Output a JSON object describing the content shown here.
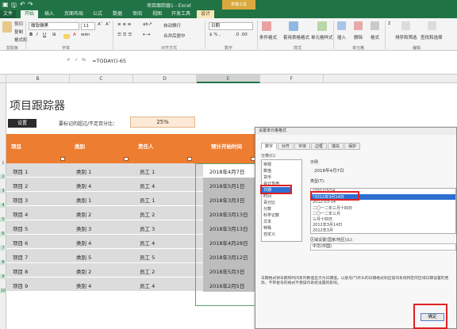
{
  "window": {
    "title": "项目跟踪器1 - Excel",
    "tool_tab": "表格工具"
  },
  "tabs": [
    "文件",
    "开始",
    "插入",
    "页面布局",
    "公式",
    "数据",
    "审阅",
    "视图",
    "开发工具",
    "设计"
  ],
  "ribbon": {
    "clipboard": {
      "cut": "剪切",
      "copy": "复制",
      "format_painter": "格式刷",
      "group": "剪贴板"
    },
    "font": {
      "name": "微软雅黑",
      "size": "11",
      "group": "字体"
    },
    "align": {
      "wrap": "自动换行",
      "merge": "合并后居中",
      "group": "对齐方式"
    },
    "number": {
      "format": "日期",
      "group": "数字"
    },
    "styles": {
      "cond": "条件格式",
      "table": "套用表格格式",
      "cell": "单元格样式",
      "group": "样式"
    },
    "cells": {
      "insert": "插入",
      "delete": "删除",
      "format": "格式",
      "group": "单元格"
    },
    "edit": {
      "sort": "排序和筛选",
      "find": "查找和选择",
      "group": "编辑"
    }
  },
  "formula": {
    "value": "=TODAY()-65"
  },
  "columns": [
    "A",
    "B",
    "C",
    "D",
    "E",
    "F"
  ],
  "rows": [
    "1",
    "2",
    "3",
    "4",
    "5",
    "6",
    "7",
    "8",
    "9",
    "10",
    "11",
    "12",
    "13"
  ],
  "sheet": {
    "title": "项目跟踪器",
    "settings_button": "设置",
    "pct_label": "要标记的超过/不足百分比：",
    "pct_value": "25%",
    "headers": [
      "项目",
      "类别",
      "责任人",
      "预计开始时间"
    ],
    "table": [
      [
        "项目 1",
        "类别 1",
        "员工 1",
        "2018年4月7日"
      ],
      [
        "项目 2",
        "类别 4",
        "员工 4",
        "2018年5月1日"
      ],
      [
        "项目 3",
        "类别 1",
        "员工 1",
        "2018年3月3日"
      ],
      [
        "项目 4",
        "类别 2",
        "员工 2",
        "2018年3月13日"
      ],
      [
        "项目 5",
        "类别 3",
        "员工 3",
        "2018年3月13日"
      ],
      [
        "项目 6",
        "类别 4",
        "员工 4",
        "2018年4月28日"
      ],
      [
        "项目 7",
        "类别 5",
        "员工 5",
        "2018年3月12日"
      ],
      [
        "项目 8",
        "类别 2",
        "员工 2",
        "2018年5月3日"
      ],
      [
        "项目 9",
        "类别 4",
        "员工 4",
        "2016年2月5日"
      ]
    ]
  },
  "dialog": {
    "title": "设置单元格格式",
    "tabs": [
      "数字",
      "对齐",
      "字体",
      "边框",
      "填充",
      "保护"
    ],
    "category_label": "分类(C):",
    "categories": [
      "常规",
      "数值",
      "货币",
      "会计专用",
      "日期",
      "时间",
      "百分比",
      "分数",
      "科学记数",
      "文本",
      "特殊",
      "自定义"
    ],
    "selected_category": 4,
    "sample_label": "示例",
    "sample_value": "2018年4月7日",
    "type_label": "类型(T):",
    "types": [
      "*2012/3/14",
      "*2012年3月14日",
      "2012-03-14",
      "二〇一二年三月十四日",
      "二〇一二年三月",
      "三月十四日",
      "2012年3月14日",
      "2012年3月"
    ],
    "selected_type": 1,
    "locale_label": "区域设置(国家/地区)(L):",
    "locale_value": "中文(中国)",
    "description": "日期格式将日期和时间系列数值显示为日期值。以星号(*)开头的日期格式响应操作系统特定的区域日期设置的更改。不带星号的格式不受操作系统设置的影响。",
    "ok": "确定"
  }
}
